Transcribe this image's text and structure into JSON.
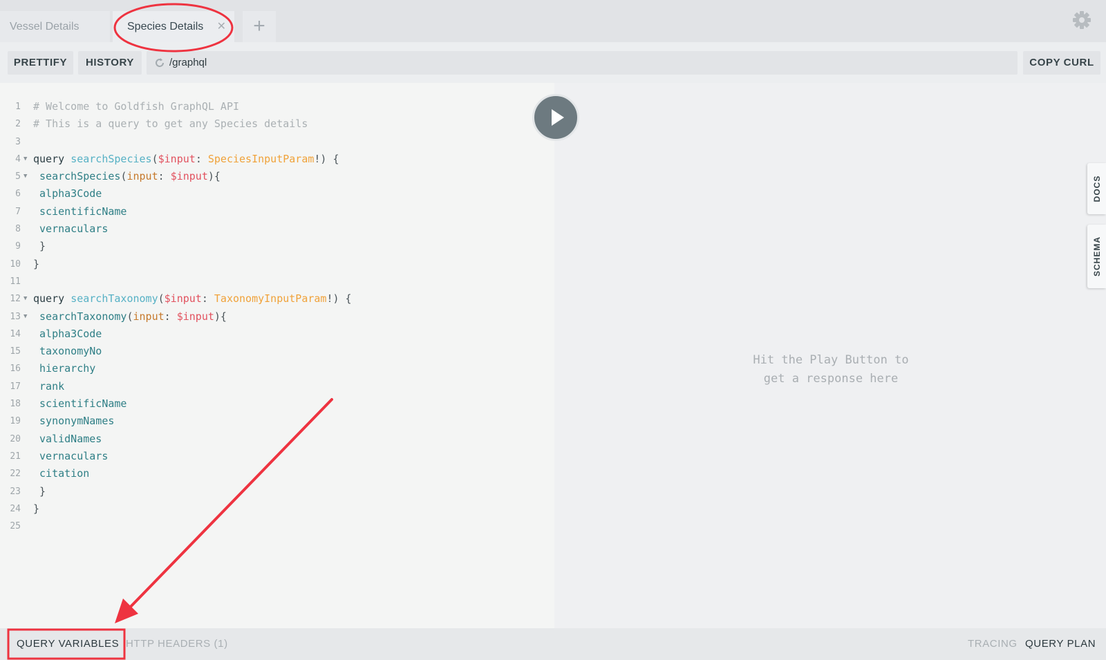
{
  "tabs": [
    {
      "label": "Vessel Details",
      "active": false
    },
    {
      "label": "Species Details",
      "active": true,
      "close": "✕"
    }
  ],
  "tab_add": "+",
  "toolbar": {
    "prettify": "PRETTIFY",
    "history": "HISTORY",
    "url": "/graphql",
    "copy_curl": "COPY CURL"
  },
  "editor": {
    "lines": [
      {
        "n": "1",
        "fold": false,
        "tokens": [
          {
            "t": "# Welcome to Goldfish GraphQL API",
            "c": "cm"
          }
        ]
      },
      {
        "n": "2",
        "fold": false,
        "tokens": [
          {
            "t": "# This is a query to get any Species details",
            "c": "cm"
          }
        ]
      },
      {
        "n": "3",
        "fold": false,
        "tokens": []
      },
      {
        "n": "4",
        "fold": true,
        "tokens": [
          {
            "t": "query ",
            "c": "kw"
          },
          {
            "t": "searchSpecies",
            "c": "def"
          },
          {
            "t": "(",
            "c": "p"
          },
          {
            "t": "$input",
            "c": "var"
          },
          {
            "t": ": ",
            "c": "p"
          },
          {
            "t": "SpeciesInputParam",
            "c": "type"
          },
          {
            "t": "!) {",
            "c": "p"
          }
        ]
      },
      {
        "n": "5",
        "fold": true,
        "tokens": [
          {
            "t": " searchSpecies",
            "c": "field"
          },
          {
            "t": "(",
            "c": "p"
          },
          {
            "t": "input",
            "c": "attr"
          },
          {
            "t": ": ",
            "c": "p"
          },
          {
            "t": "$input",
            "c": "var"
          },
          {
            "t": "){",
            "c": "p"
          }
        ]
      },
      {
        "n": "6",
        "fold": false,
        "tokens": [
          {
            "t": " alpha3Code",
            "c": "field"
          }
        ]
      },
      {
        "n": "7",
        "fold": false,
        "tokens": [
          {
            "t": " scientificName",
            "c": "field"
          }
        ]
      },
      {
        "n": "8",
        "fold": false,
        "tokens": [
          {
            "t": " vernaculars",
            "c": "field"
          }
        ]
      },
      {
        "n": "9",
        "fold": false,
        "tokens": [
          {
            "t": " }",
            "c": "p"
          }
        ]
      },
      {
        "n": "10",
        "fold": false,
        "tokens": [
          {
            "t": "}",
            "c": "p"
          }
        ]
      },
      {
        "n": "11",
        "fold": false,
        "tokens": []
      },
      {
        "n": "12",
        "fold": true,
        "tokens": [
          {
            "t": "query ",
            "c": "kw"
          },
          {
            "t": "searchTaxonomy",
            "c": "def"
          },
          {
            "t": "(",
            "c": "p"
          },
          {
            "t": "$input",
            "c": "var"
          },
          {
            "t": ": ",
            "c": "p"
          },
          {
            "t": "TaxonomyInputParam",
            "c": "type"
          },
          {
            "t": "!) {",
            "c": "p"
          }
        ]
      },
      {
        "n": "13",
        "fold": true,
        "tokens": [
          {
            "t": " searchTaxonomy",
            "c": "field"
          },
          {
            "t": "(",
            "c": "p"
          },
          {
            "t": "input",
            "c": "attr"
          },
          {
            "t": ": ",
            "c": "p"
          },
          {
            "t": "$input",
            "c": "var"
          },
          {
            "t": "){",
            "c": "p"
          }
        ]
      },
      {
        "n": "14",
        "fold": false,
        "tokens": [
          {
            "t": " alpha3Code",
            "c": "field"
          }
        ]
      },
      {
        "n": "15",
        "fold": false,
        "tokens": [
          {
            "t": " taxonomyNo",
            "c": "field"
          }
        ]
      },
      {
        "n": "16",
        "fold": false,
        "tokens": [
          {
            "t": " hierarchy",
            "c": "field"
          }
        ]
      },
      {
        "n": "17",
        "fold": false,
        "tokens": [
          {
            "t": " rank",
            "c": "field"
          }
        ]
      },
      {
        "n": "18",
        "fold": false,
        "tokens": [
          {
            "t": " scientificName",
            "c": "field"
          }
        ]
      },
      {
        "n": "19",
        "fold": false,
        "tokens": [
          {
            "t": " synonymNames",
            "c": "field"
          }
        ]
      },
      {
        "n": "20",
        "fold": false,
        "tokens": [
          {
            "t": " validNames",
            "c": "field"
          }
        ]
      },
      {
        "n": "21",
        "fold": false,
        "tokens": [
          {
            "t": " vernaculars",
            "c": "field"
          }
        ]
      },
      {
        "n": "22",
        "fold": false,
        "tokens": [
          {
            "t": " citation",
            "c": "field"
          }
        ]
      },
      {
        "n": "23",
        "fold": false,
        "tokens": [
          {
            "t": " }",
            "c": "p"
          }
        ]
      },
      {
        "n": "24",
        "fold": false,
        "tokens": [
          {
            "t": "}",
            "c": "p"
          }
        ]
      },
      {
        "n": "25",
        "fold": false,
        "tokens": []
      }
    ]
  },
  "result": {
    "hint_line1": "Hit the Play Button to",
    "hint_line2": "get a response here"
  },
  "side_tabs": {
    "docs": "DOCS",
    "schema": "SCHEMA"
  },
  "bottom": {
    "query_variables": "QUERY VARIABLES",
    "http_headers": "HTTP HEADERS (1)",
    "tracing": "TRACING",
    "query_plan": "QUERY PLAN"
  },
  "icons": {
    "gear": "gear-icon",
    "play": "play-icon",
    "reload": "reload-icon",
    "close": "close-icon",
    "add": "plus-icon"
  },
  "colors": {
    "annotation": "#ee3340",
    "play_button": "#6d7a80",
    "comment": "#aab0b3",
    "definition": "#56b1c5",
    "variable": "#e2525f",
    "type": "#f0a23a",
    "field": "#2f7f86"
  }
}
